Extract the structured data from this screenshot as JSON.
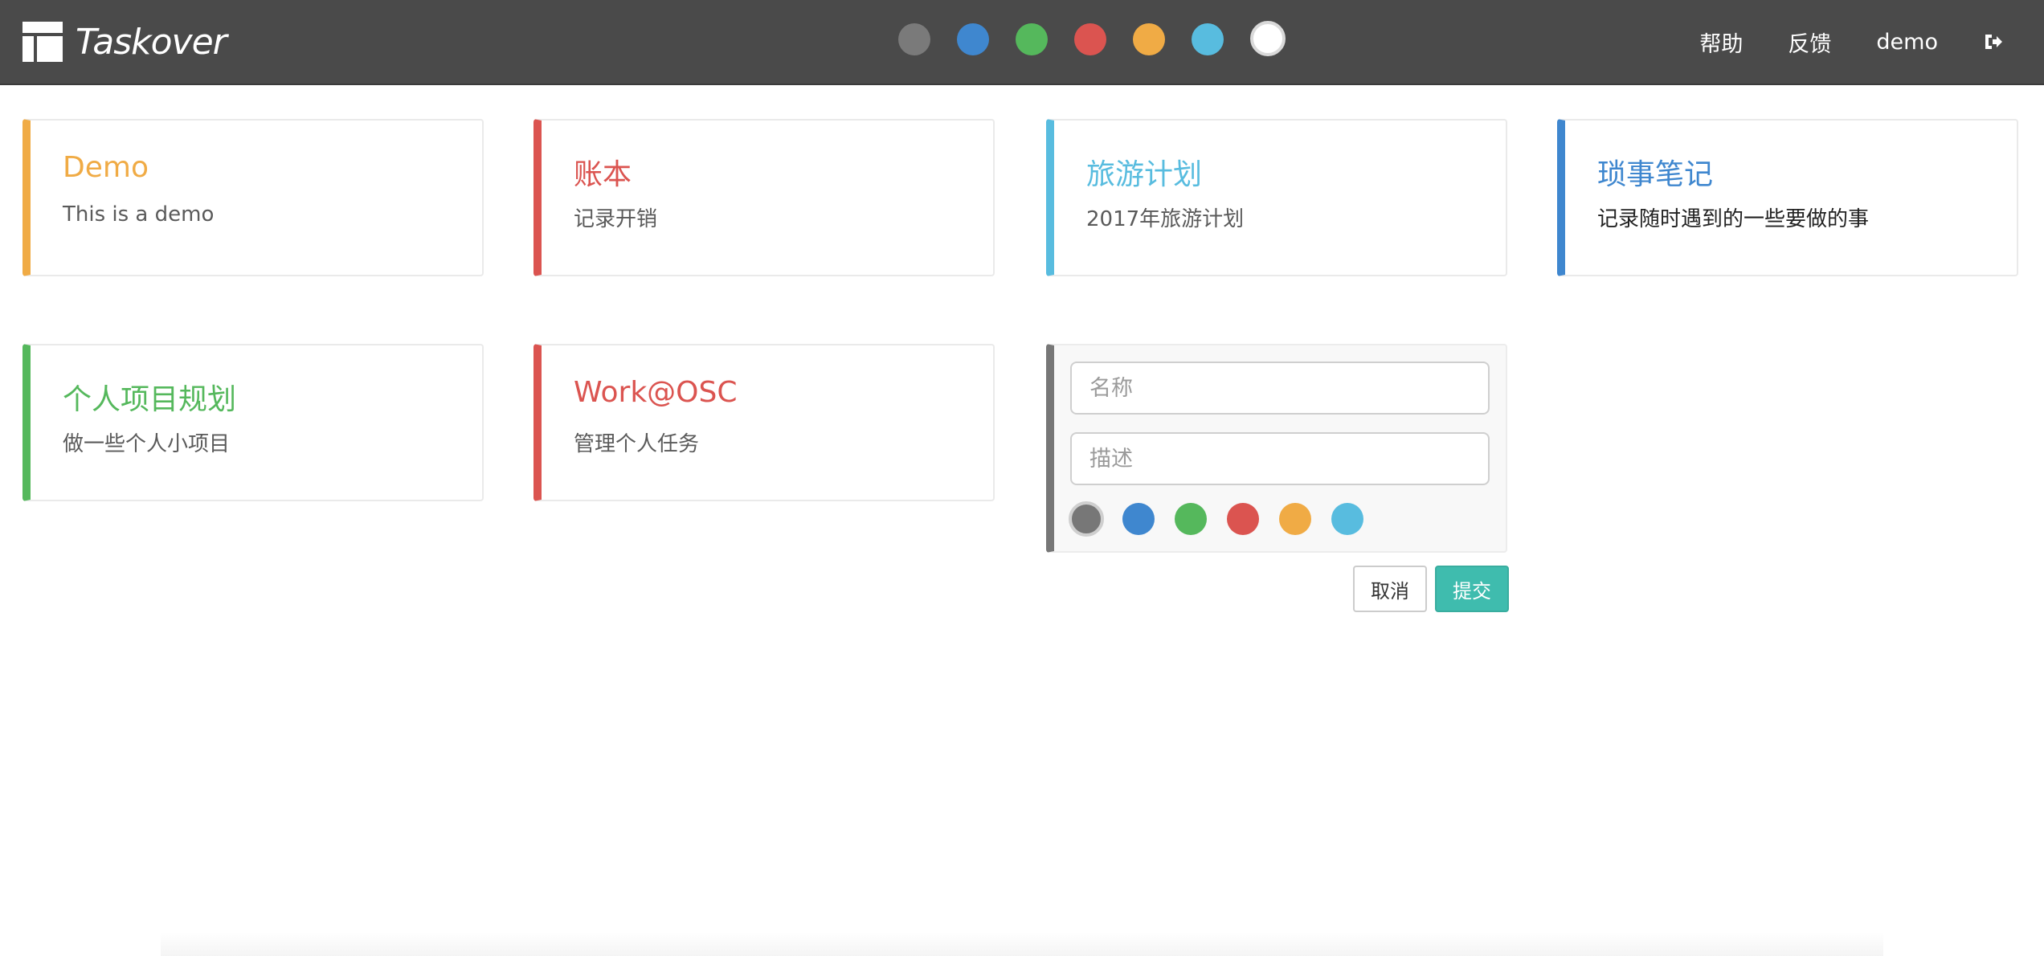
{
  "app": {
    "name": "Taskover"
  },
  "theme_colors": [
    {
      "name": "gray",
      "hex": "#7a7a7a"
    },
    {
      "name": "blue",
      "hex": "#3f87cf"
    },
    {
      "name": "green",
      "hex": "#55b85c"
    },
    {
      "name": "red",
      "hex": "#db5450"
    },
    {
      "name": "orange",
      "hex": "#f0ab45"
    },
    {
      "name": "cyan",
      "hex": "#58bcdf"
    },
    {
      "name": "white",
      "hex": "#ffffff",
      "active": true
    }
  ],
  "nav": {
    "help": "帮助",
    "feedback": "反馈",
    "user": "demo",
    "logout_icon": "sign-out-icon"
  },
  "boards": [
    {
      "title": "Demo",
      "description": "This is a demo",
      "color": "#f0ab45"
    },
    {
      "title": "账本",
      "description": "记录开销",
      "color": "#db5450"
    },
    {
      "title": "旅游计划",
      "description": "2017年旅游计划",
      "color": "#58bcdf"
    },
    {
      "title": "琐事笔记",
      "description": "记录随时遇到的一些要做的事",
      "color": "#3f87cf"
    },
    {
      "title": "个人项目规划",
      "description": "做一些个人小项目",
      "color": "#55b85c"
    },
    {
      "title": "Work@OSC",
      "description": "管理个人任务",
      "color": "#db5450"
    }
  ],
  "new_board_form": {
    "name_placeholder": "名称",
    "name_value": "",
    "description_placeholder": "描述",
    "description_value": "",
    "colors": [
      {
        "name": "gray",
        "hex": "#777777",
        "selected": true
      },
      {
        "name": "blue",
        "hex": "#3f87cf"
      },
      {
        "name": "green",
        "hex": "#55b85c"
      },
      {
        "name": "red",
        "hex": "#db5450"
      },
      {
        "name": "orange",
        "hex": "#f0ab45"
      },
      {
        "name": "cyan",
        "hex": "#58bcdf"
      }
    ],
    "cancel_label": "取消",
    "submit_label": "提交"
  }
}
